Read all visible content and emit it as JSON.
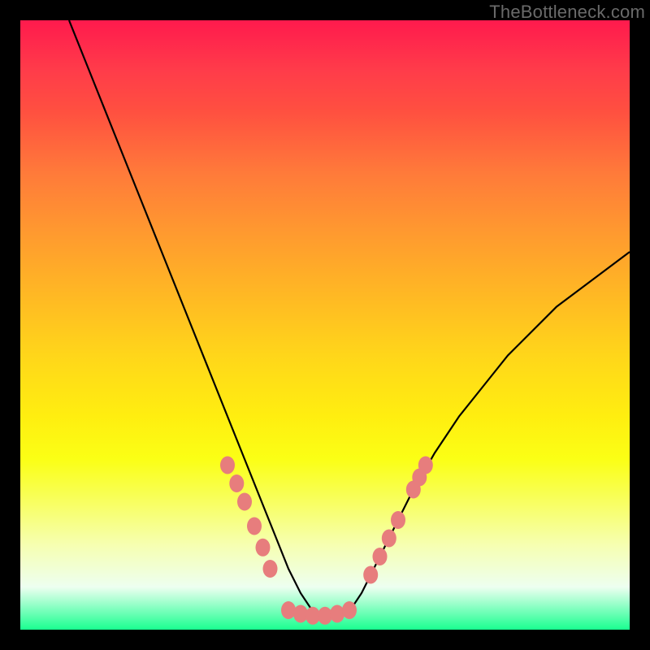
{
  "watermark": {
    "text": "TheBottleneck.com"
  },
  "colors": {
    "background": "#000000",
    "curve_stroke": "#000000",
    "marker_fill": "#e77d7d",
    "marker_stroke": "#c76262"
  },
  "chart_data": {
    "type": "line",
    "title": "",
    "xlabel": "",
    "ylabel": "",
    "xlim": [
      0,
      100
    ],
    "ylim": [
      0,
      100
    ],
    "grid": false,
    "legend": false,
    "note": "Values are percentages of plot width/height read from pixels; y=0 at bottom, y=100 at top. Curve is a bottleneck-style V with minimum near x≈48.",
    "series": [
      {
        "name": "bottleneck-curve",
        "x": [
          8,
          12,
          16,
          20,
          24,
          28,
          32,
          34,
          36,
          38,
          40,
          42,
          44,
          46,
          48,
          50,
          52,
          54,
          56,
          58,
          60,
          64,
          68,
          72,
          76,
          80,
          84,
          88,
          92,
          96,
          100
        ],
        "y": [
          100,
          90,
          80,
          70,
          60,
          50,
          40,
          35,
          30,
          25,
          20,
          15,
          10,
          6,
          3,
          2,
          2,
          3,
          6,
          10,
          14,
          22,
          29,
          35,
          40,
          45,
          49,
          53,
          56,
          59,
          62
        ]
      }
    ],
    "markers": {
      "name": "salmon-dots",
      "note": "Clustered near the valley and lower arms of the curve.",
      "points": [
        {
          "x": 34.0,
          "y": 27.0
        },
        {
          "x": 35.5,
          "y": 24.0
        },
        {
          "x": 36.8,
          "y": 21.0
        },
        {
          "x": 38.4,
          "y": 17.0
        },
        {
          "x": 39.8,
          "y": 13.5
        },
        {
          "x": 41.0,
          "y": 10.0
        },
        {
          "x": 44.0,
          "y": 3.2
        },
        {
          "x": 46.0,
          "y": 2.6
        },
        {
          "x": 48.0,
          "y": 2.3
        },
        {
          "x": 50.0,
          "y": 2.3
        },
        {
          "x": 52.0,
          "y": 2.6
        },
        {
          "x": 54.0,
          "y": 3.2
        },
        {
          "x": 57.5,
          "y": 9.0
        },
        {
          "x": 59.0,
          "y": 12.0
        },
        {
          "x": 60.5,
          "y": 15.0
        },
        {
          "x": 62.0,
          "y": 18.0
        },
        {
          "x": 64.5,
          "y": 23.0
        },
        {
          "x": 65.5,
          "y": 25.0
        },
        {
          "x": 66.5,
          "y": 27.0
        }
      ]
    }
  }
}
